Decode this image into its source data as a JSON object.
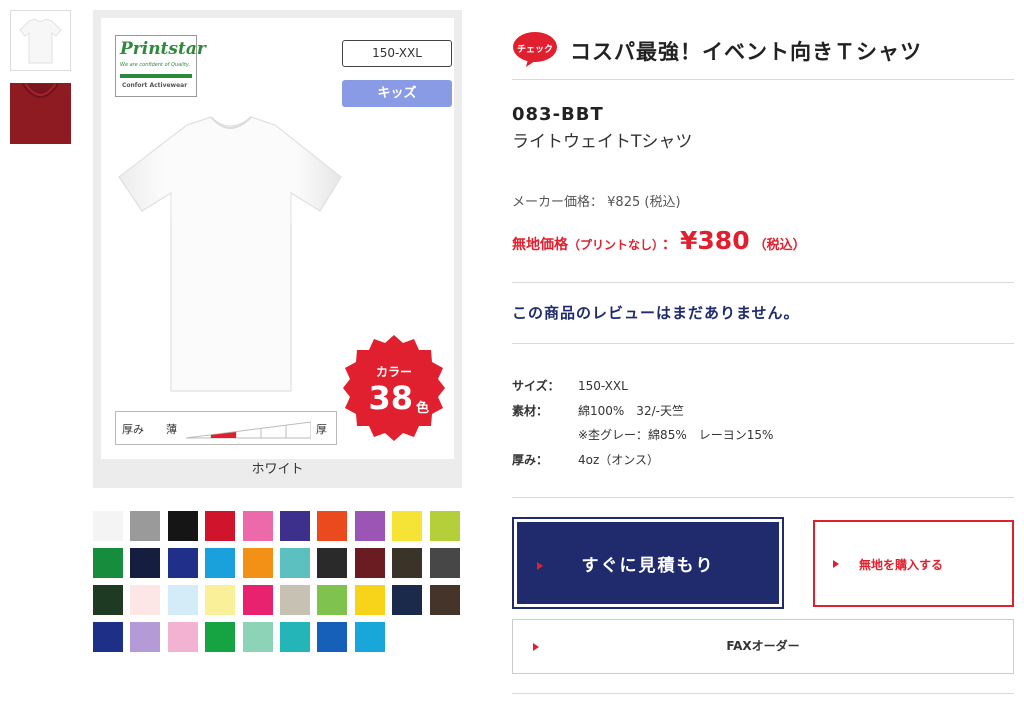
{
  "gallery": {
    "thumbnails": [
      {
        "color": "#ffffff",
        "icon": "white-tshirt-thumbnail"
      },
      {
        "color": "#8e1a22",
        "icon": "red-tshirt-thumbnail"
      }
    ],
    "brand_logo": {
      "script": "Printstar",
      "tagline": "We are confident of Quality.",
      "sub": "Confort Activewear"
    },
    "size_range": "150-XXL",
    "kids_label": "キッズ",
    "color_badge": {
      "label": "カラー",
      "count": "38",
      "unit": "色",
      "color": "#e0202e"
    },
    "thickness": {
      "label": "厚み",
      "thin": "薄",
      "thick": "厚",
      "level": 2,
      "max_level": 5
    },
    "caption": "ホワイト"
  },
  "swatches": [
    "#f4f4f4",
    "#9a9a9a",
    "#151515",
    "#d0142b",
    "#ec6aa9",
    "#3d2f8c",
    "#ea4a1d",
    "#9a55b5",
    "#f5e335",
    "#b5cf3a",
    "#158d3d",
    "#151e3e",
    "#1f2f8a",
    "#1aa0da",
    "#f39117",
    "#5cbfc0",
    "#2a2a2a",
    "#6b1b22",
    "#3a3428",
    "#474747",
    "#1e3a22",
    "#fde6e6",
    "#d3ecf7",
    "#fbf09a",
    "#e8226f",
    "#c7c1b3",
    "#7fc24e",
    "#f7d31a",
    "#1b2a4a",
    "#45342a",
    "#1d2f86",
    "#b49ad6",
    "#f2b3d3",
    "#16a342",
    "#8cd3b7",
    "#23b5b8",
    "#1660ba",
    "#19a6d8"
  ],
  "product": {
    "check_badge": "チェック",
    "headline": "コスパ最強！イベント向きＴシャツ",
    "code": "083-BBT",
    "name": "ライトウェイトTシャツ",
    "maker_price_label": "メーカー価格：",
    "maker_price": "¥825 (税込)",
    "plain_price_label": "無地価格",
    "plain_price_note": "（プリントなし）",
    "plain_price_colon": "：",
    "plain_price": "¥380",
    "plain_price_tax": "（税込）",
    "review_text": "この商品のレビューはまだありません。",
    "specs": [
      {
        "key": "サイズ：",
        "value": "150-XXL"
      },
      {
        "key": "素材：",
        "value": "綿100%　32/-天竺"
      },
      {
        "key": "",
        "value": "※杢グレー：綿85%　レーヨン15%"
      },
      {
        "key": "厚み：",
        "value": "4oz（オンス）"
      }
    ]
  },
  "actions": {
    "quote": "すぐに見積もり",
    "buy_plain": "無地を購入する",
    "fax": "FAXオーダー"
  },
  "colors": {
    "navy": "#1f2b6d",
    "red": "#e0202e",
    "kids": "#8a9be6"
  }
}
